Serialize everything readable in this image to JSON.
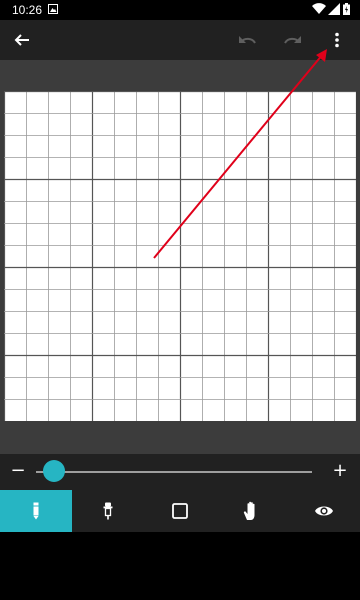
{
  "status_bar": {
    "time": "10:26",
    "icons": [
      "notification-icon",
      "wifi-icon",
      "signal-icon",
      "battery-icon"
    ]
  },
  "app_bar": {
    "icons": [
      "back-arrow-icon",
      "undo-icon",
      "redo-icon",
      "more-vert-icon"
    ]
  },
  "slider": {
    "minus_label": "−",
    "plus_label": "+",
    "value_fraction": 0.03
  },
  "toolbar": {
    "tools": [
      {
        "icon": "pencil-icon",
        "active": true
      },
      {
        "icon": "eyedropper-icon",
        "active": false
      },
      {
        "icon": "square-icon",
        "active": false
      },
      {
        "icon": "hand-icon",
        "active": false
      },
      {
        "icon": "eye-icon",
        "active": false
      }
    ]
  },
  "annotation": {
    "arrow_color": "#e0001a"
  },
  "colors": {
    "accent": "#26b5c3",
    "app_bar": "#212121",
    "canvas_background": "#3c3c3c"
  }
}
